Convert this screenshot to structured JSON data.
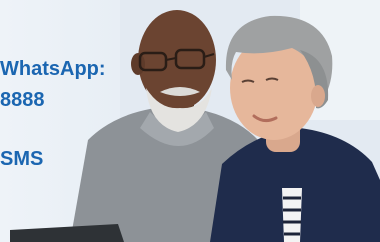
{
  "banner": {
    "whatsapp_label": "WhatsApp:",
    "whatsapp_number": "8888",
    "sms_label": "SMS"
  },
  "colors": {
    "text_blue": "#1b66b1",
    "background": "#e6edf4"
  }
}
